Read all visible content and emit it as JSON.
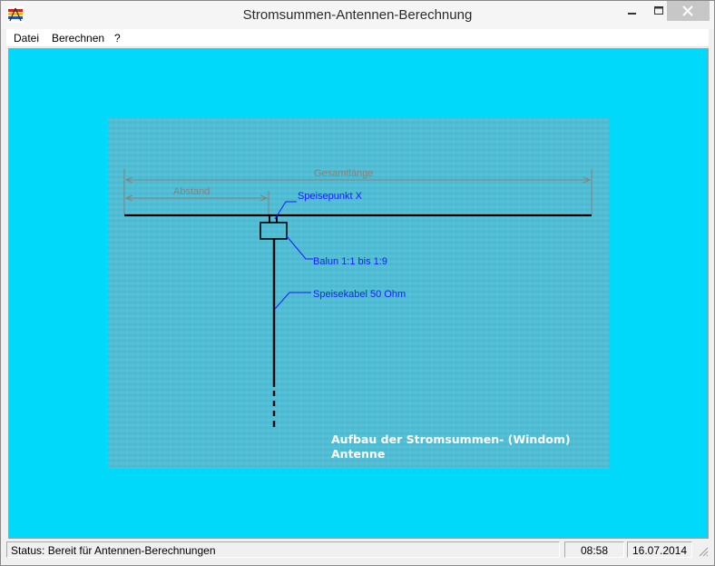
{
  "window": {
    "title": "Stromsummen-Antennen-Berechnung"
  },
  "menu": {
    "items": [
      "Datei",
      "Berechnen",
      "?"
    ]
  },
  "diagram": {
    "labels": {
      "gesamtlaenge": "Gesamtlänge",
      "abstand": "Abstand",
      "speisepunkt": "Speisepunkt X",
      "balun": "Balun 1:1 bis 1:9",
      "speisekabel": "Speisekabel 50 Ohm"
    },
    "caption": {
      "line1": "Aufbau der Stromsummen- (Windom)",
      "line2": "Antenne"
    }
  },
  "statusbar": {
    "status": "Status: Bereit für Antennen-Berechnungen",
    "time": "08:58",
    "date": "16.07.2014"
  },
  "colors": {
    "client_bg": "#00d9fa",
    "diagram_bg": "#4fbcd4",
    "dimension": "#8a7f78",
    "label_blue": "#1a1aff"
  }
}
